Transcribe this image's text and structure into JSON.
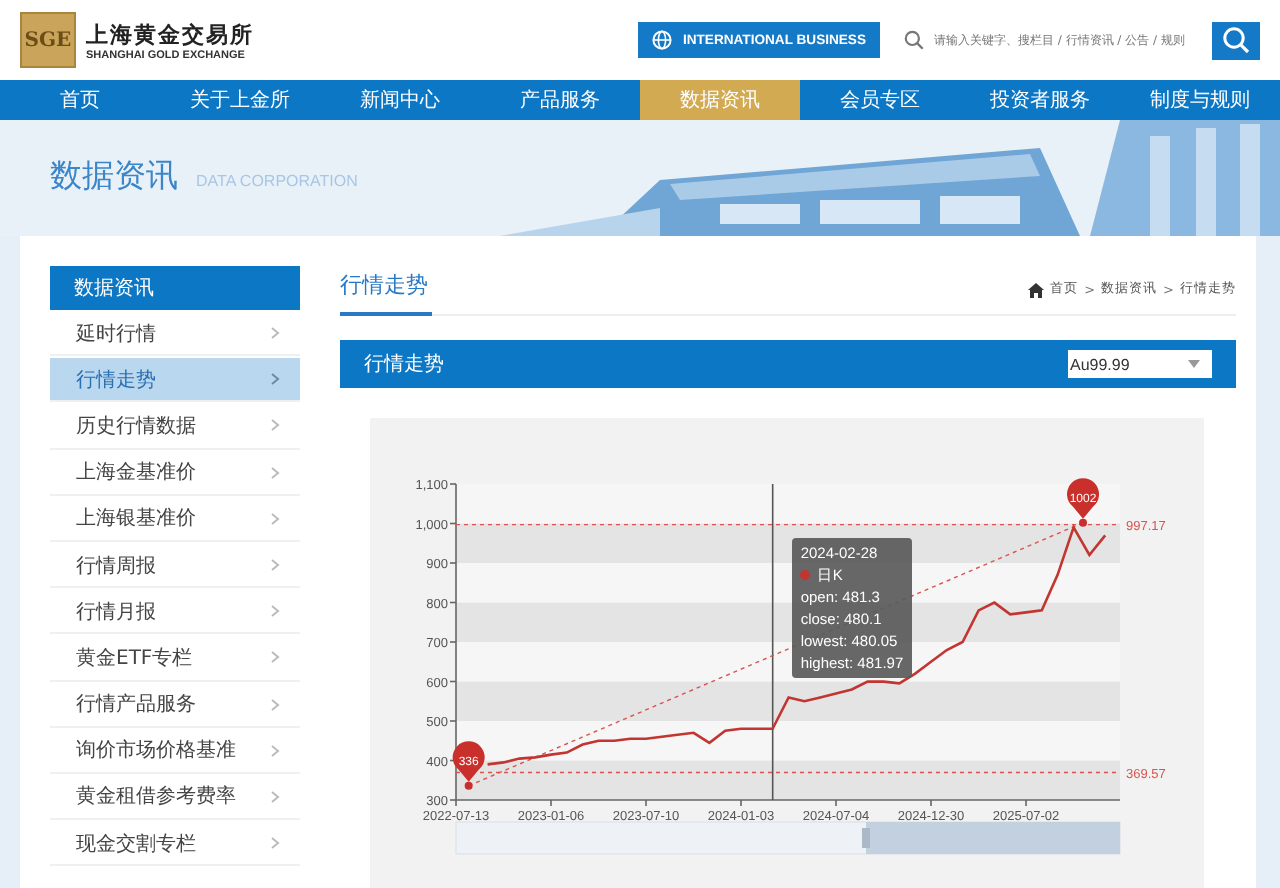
{
  "header": {
    "logo_mark": "SGE",
    "logo_name": "上海黄金交易所",
    "logo_english": "SHANGHAI GOLD EXCHANGE",
    "intl_button": "INTERNATIONAL BUSINESS",
    "search": {
      "placeholder": "请输入关键字、搜栏目 / 行情资讯 / 公告 / 规则"
    }
  },
  "nav": [
    {
      "label": "首页",
      "selected": false
    },
    {
      "label": "关于上金所",
      "selected": false
    },
    {
      "label": "新闻中心",
      "selected": false
    },
    {
      "label": "产品服务",
      "selected": false
    },
    {
      "label": "数据资讯",
      "selected": true
    },
    {
      "label": "会员专区",
      "selected": false
    },
    {
      "label": "投资者服务",
      "selected": false
    },
    {
      "label": "制度与规则",
      "selected": false
    }
  ],
  "banner": {
    "title": "数据资讯",
    "subtitle": "DATA CORPORATION"
  },
  "sidebar": {
    "title": "数据资讯",
    "items": [
      {
        "label": "延时行情",
        "selected": false
      },
      {
        "label": "行情走势",
        "selected": true
      },
      {
        "label": "历史行情数据",
        "selected": false
      },
      {
        "label": "上海金基准价",
        "selected": false
      },
      {
        "label": "上海银基准价",
        "selected": false
      },
      {
        "label": "行情周报",
        "selected": false
      },
      {
        "label": "行情月报",
        "selected": false
      },
      {
        "label": "黄金ETF专栏",
        "selected": false
      },
      {
        "label": "行情产品服务",
        "selected": false
      },
      {
        "label": "询价市场价格基准",
        "selected": false
      },
      {
        "label": "黄金租借参考费率",
        "selected": false
      },
      {
        "label": "现金交割专栏",
        "selected": false
      }
    ]
  },
  "main": {
    "page_title": "行情走势",
    "breadcrumb": [
      "首页",
      "数据资讯",
      "行情走势"
    ],
    "breadcrumb_separator": ">",
    "panel": {
      "title": "行情走势",
      "instrument_select": "Au99.99",
      "chart_data": {
        "type": "line",
        "categories": [
          "2022-07-13",
          null,
          null,
          null,
          null,
          null,
          "2023-01-06",
          null,
          null,
          null,
          null,
          null,
          "2023-07-10",
          null,
          null,
          null,
          null,
          null,
          "2024-01-03",
          null,
          null,
          null,
          null,
          null,
          "2024-07-04",
          null,
          null,
          null,
          null,
          null,
          "2024-12-30",
          null,
          null,
          null,
          null,
          null,
          "2025-07-02",
          null,
          null,
          null,
          null,
          null
        ],
        "series": [
          {
            "name": "日K",
            "color": "#c23531",
            "values": [
              null,
              null,
              390,
              395,
              405,
              408,
              415,
              420,
              440,
              450,
              450,
              455,
              455,
              460,
              465,
              470,
              445,
              475,
              480,
              480,
              480,
              560,
              550,
              560,
              570,
              580,
              600,
              600,
              595,
              620,
              650,
              680,
              700,
              780,
              800,
              770,
              775,
              780,
              870,
              990,
              920,
              970
            ]
          }
        ],
        "ylim": [
          300,
          1100
        ],
        "yticks": [
          300,
          400,
          500,
          600,
          700,
          800,
          900,
          {
            "value": 1000,
            "label": "1,000"
          },
          {
            "value": 1100,
            "label": "1,100"
          }
        ],
        "ref_lines": [
          {
            "axis": "y",
            "value": 997.17,
            "label": "997.17",
            "color": "#d9534f"
          },
          {
            "axis": "y",
            "value": 369.57,
            "label": "369.57",
            "color": "#d9534f"
          }
        ],
        "annotations": [
          {
            "text": "336",
            "y": 336
          },
          {
            "text": "1002",
            "y": 1002
          }
        ]
      },
      "tooltip": {
        "date": "2024-02-28",
        "rows": [
          "open: 481.3",
          "close: 480.1",
          "lowest: 480.05",
          "highest: 481.97"
        ]
      }
    }
  }
}
